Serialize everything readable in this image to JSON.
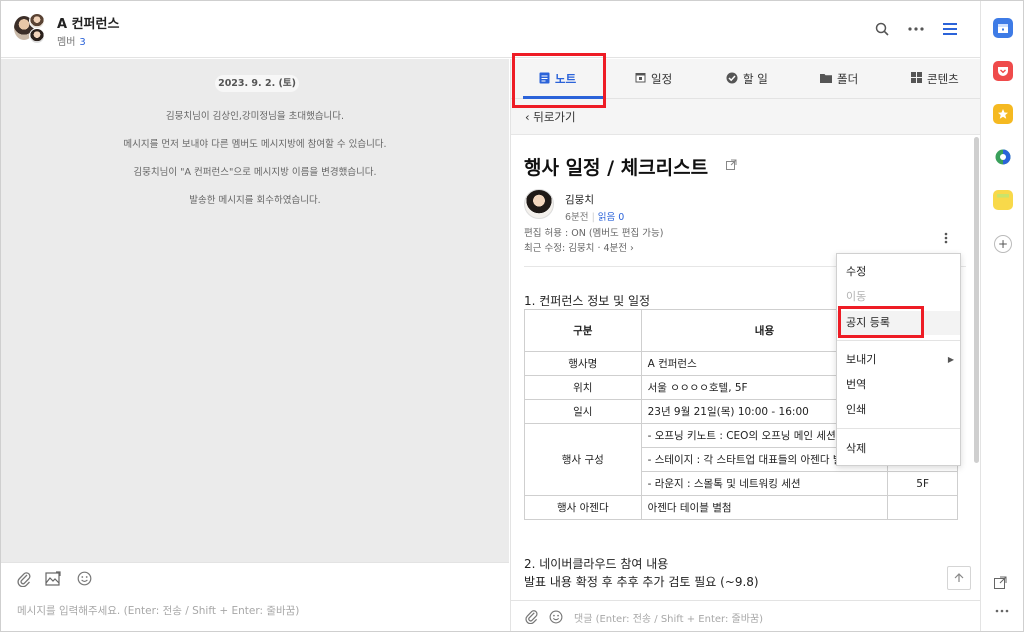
{
  "header": {
    "title": "A 컨퍼런스",
    "member_label": "멤버",
    "member_count": "3",
    "icons": [
      "search-icon",
      "more-icon",
      "menu-icon"
    ]
  },
  "chat": {
    "date": "2023. 9. 2. (토)",
    "messages": [
      "김뭉치님이 김상인,강미정님을 초대했습니다.",
      "메시지를 먼저 보내야 다른 멤버도 메시지방에 참여할 수 있습니다.",
      "김뭉치님이 \"A 컨퍼런스\"으로 메시지방 이름을 변경했습니다.",
      "발송한 메시지를 회수하였습니다."
    ],
    "composer_placeholder": "메시지를 입력해주세요. (Enter: 전송 / Shift + Enter: 줄바꿈)"
  },
  "tabs": [
    {
      "label": "노트",
      "icon": "note-icon"
    },
    {
      "label": "일정",
      "icon": "calendar-icon"
    },
    {
      "label": "할 일",
      "icon": "check-icon"
    },
    {
      "label": "폴더",
      "icon": "folder-icon"
    },
    {
      "label": "콘텐츠",
      "icon": "content-icon"
    }
  ],
  "note": {
    "back_label": "뒤로가기",
    "title": "행사 일정 / 체크리스트",
    "author": "김뭉치",
    "time_ago": "6분전",
    "read_label": "읽음 0",
    "edit_permission": "편집 허용 : ON (멤버도 편집 가능)",
    "last_edit": "최근 수정: 김뭉치 · 4분전",
    "section1": "1. 컨퍼런스 정보 및 일정",
    "table": {
      "headers": [
        "구분",
        "내용",
        ""
      ],
      "rows": [
        [
          "행사명",
          "A 컨퍼런스",
          ""
        ],
        [
          "위치",
          "서울 ㅇㅇㅇㅇ호텔, 5F",
          ""
        ],
        [
          "일시",
          "23년 9월 21일(목) 10:00 - 16:00",
          ""
        ],
        [
          "행사 구성",
          "- 오프닝 키노트 : CEO의 오프닝 메인 세션",
          ""
        ],
        [
          "",
          "- 스테이지 : 각 스타트업 대표들의 아젠다 발표",
          ""
        ],
        [
          "",
          "- 라운지 : 스몰톡 및 네트워킹 세션",
          "5F"
        ],
        [
          "행사 아젠다",
          "아젠다 테이블 별첨",
          ""
        ]
      ]
    },
    "section2": "2. 네이버클라우드 참여 내용",
    "section2_line": "발표 내용 확정 후 추후 추가 검토 필요 (~9.8)",
    "comment_placeholder": "댓글 (Enter: 전송 / Shift + Enter: 줄바꿈)"
  },
  "context_menu": {
    "items": [
      "수정",
      "이동",
      "공지 등록",
      "보내기",
      "번역",
      "인쇄",
      "삭제"
    ]
  },
  "colors": {
    "accent": "#2b63d9",
    "highlight_box": "#ee1c25"
  }
}
